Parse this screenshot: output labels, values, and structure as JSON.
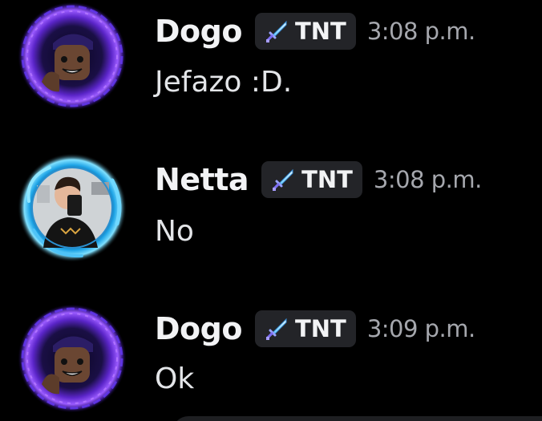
{
  "messages": [
    {
      "author": "Dogo",
      "avatar_icon": "lego-minifig-portal-avatar",
      "role_tag": {
        "icon": "diamond-sword-icon",
        "label": "TNT"
      },
      "timestamp": "3:08 p.m.",
      "text": "Jefazo :D."
    },
    {
      "author": "Netta",
      "avatar_icon": "photo-avatar-blue-swirl",
      "role_tag": {
        "icon": "diamond-sword-icon",
        "label": "TNT"
      },
      "timestamp": "3:08 p.m.",
      "text": "No"
    },
    {
      "author": "Dogo",
      "avatar_icon": "lego-minifig-portal-avatar",
      "role_tag": {
        "icon": "diamond-sword-icon",
        "label": "TNT"
      },
      "timestamp": "3:09 p.m.",
      "text": "Ok"
    }
  ],
  "colors": {
    "background": "#000000",
    "username": "#f2f3f5",
    "timestamp": "#a5a7ad",
    "tag_background": "#232428",
    "portal_purple": "#8a3df0",
    "swirl_blue": "#4fc3f7"
  }
}
